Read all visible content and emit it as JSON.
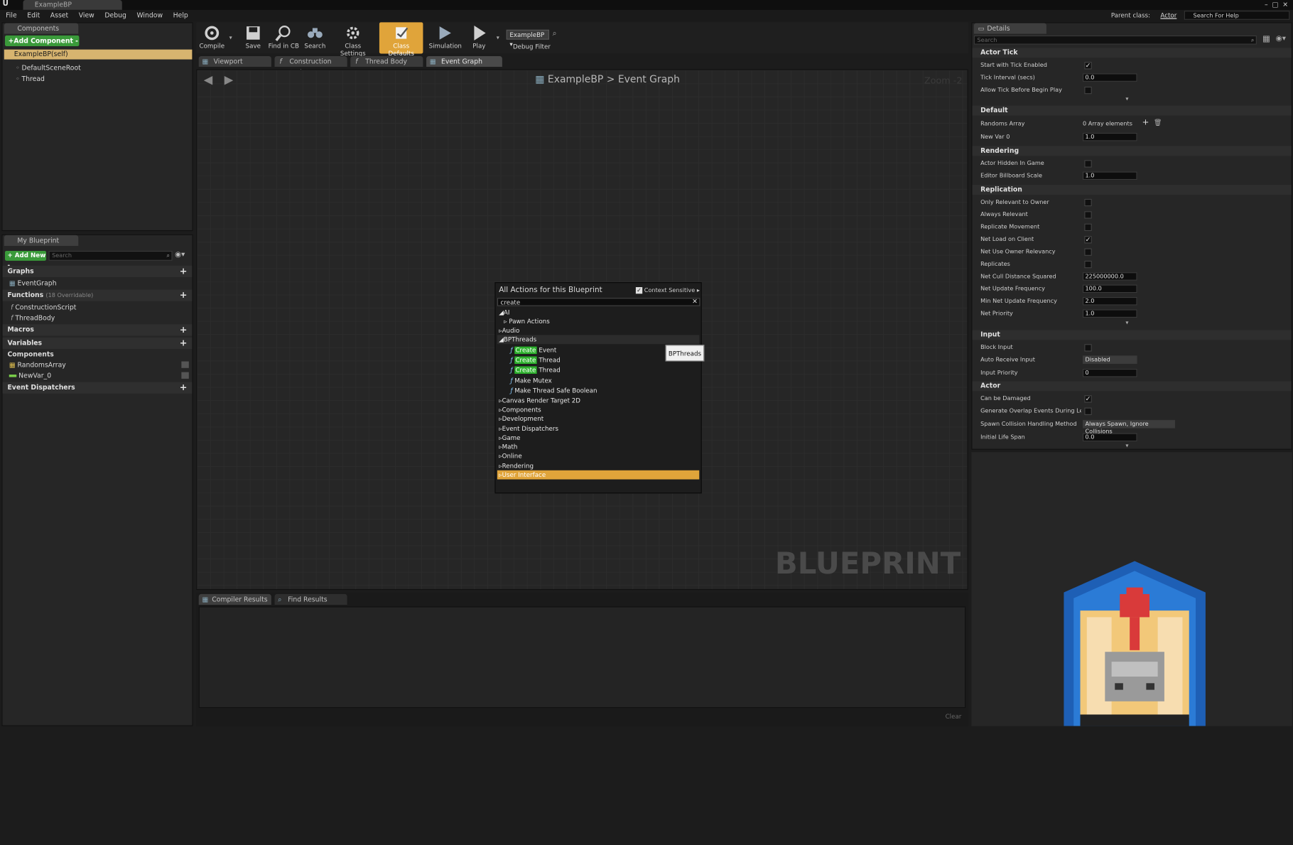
{
  "window": {
    "title": "ExampleBP"
  },
  "menu": [
    "File",
    "Edit",
    "Asset",
    "View",
    "Debug",
    "Window",
    "Help"
  ],
  "top_right": {
    "parent_class_label": "Parent class:",
    "parent_class_value": "Actor",
    "help_search_placeholder": "Search For Help"
  },
  "components": {
    "tab": "Components",
    "add_button": "+Add Component -",
    "items": [
      "ExampleBP(self)",
      "DefaultSceneRoot",
      "Thread"
    ]
  },
  "my_blueprint": {
    "tab": "My Blueprint",
    "add_new": "+ Add New -",
    "search_placeholder": "Search",
    "graphs_label": "Graphs",
    "graphs": [
      "EventGraph"
    ],
    "functions_label": "Functions",
    "functions_overridable": "(18 Overridable)",
    "functions": [
      "ConstructionScript",
      "ThreadBody"
    ],
    "macros_label": "Macros",
    "variables_label": "Variables",
    "components_label": "Components",
    "variables": [
      "RandomsArray",
      "NewVar_0"
    ],
    "dispatchers_label": "Event Dispatchers"
  },
  "toolbar": {
    "compile": "Compile",
    "save": "Save",
    "find_cb": "Find in CB",
    "search": "Search",
    "class_settings": "Class Settings",
    "class_defaults": "Class Defaults",
    "simulation": "Simulation",
    "play": "Play",
    "debug_select": "ExampleBP",
    "debug_filter": "Debug Filter"
  },
  "graph_tabs": [
    "Viewport",
    "Construction Script",
    "Thread Body",
    "Event Graph"
  ],
  "graph": {
    "breadcrumb_root": "ExampleBP",
    "breadcrumb_sep": ">",
    "breadcrumb_leaf": "Event Graph",
    "zoom": "Zoom -2",
    "watermark": "BLUEPRINT"
  },
  "actions": {
    "title": "All Actions for this Blueprint",
    "context_sensitive": "Context Sensitive",
    "search_value": "create",
    "tooltip": "BPThreads",
    "ai": "AI",
    "pawn_actions": "Pawn Actions",
    "audio": "Audio",
    "bpthreads": "BPThreads",
    "create_word": "Create",
    "create_event_rest": " Event",
    "create_thread_rest": " Thread",
    "make_mutex": "Make Mutex",
    "make_bool": "Make Thread Safe Boolean",
    "categories": [
      "Canvas Render Target 2D",
      "Components",
      "Development",
      "Event Dispatchers",
      "Game",
      "Math",
      "Online",
      "Rendering"
    ],
    "selected": "User Interface"
  },
  "bottom": {
    "tabs": [
      "Compiler Results",
      "Find Results"
    ],
    "clear": "Clear"
  },
  "details": {
    "tab": "Details",
    "search_placeholder": "Search",
    "sections": {
      "actor_tick": "Actor Tick",
      "default": "Default",
      "rendering": "Rendering",
      "replication": "Replication",
      "input": "Input",
      "actor": "Actor"
    },
    "actor_tick": {
      "start_tick": "Start with Tick Enabled",
      "tick_interval": "Tick Interval (secs)",
      "tick_interval_val": "0.0",
      "allow_tick": "Allow Tick Before Begin Play"
    },
    "default": {
      "randoms": "Randoms Array",
      "randoms_val": "0 Array elements",
      "newvar": "New Var 0",
      "newvar_val": "1.0"
    },
    "rendering": {
      "hidden": "Actor Hidden In Game",
      "billboard": "Editor Billboard Scale",
      "billboard_val": "1.0"
    },
    "replication": {
      "only_relevant": "Only Relevant to Owner",
      "always_relevant": "Always Relevant",
      "rep_movement": "Replicate Movement",
      "net_load": "Net Load on Client",
      "net_use_owner": "Net Use Owner Relevancy",
      "replicates": "Replicates",
      "cull": "Net Cull Distance Squared",
      "cull_val": "225000000.0",
      "update_freq": "Net Update Frequency",
      "update_freq_val": "100.0",
      "min_update": "Min Net Update Frequency",
      "min_update_val": "2.0",
      "priority": "Net Priority",
      "priority_val": "1.0"
    },
    "input": {
      "block": "Block Input",
      "auto_receive": "Auto Receive Input",
      "auto_receive_val": "Disabled",
      "priority": "Input Priority",
      "priority_val": "0"
    },
    "actor": {
      "damaged": "Can be Damaged",
      "overlap": "Generate Overlap Events During Level S",
      "spawn": "Spawn Collision Handling Method",
      "spawn_val": "Always Spawn, Ignore Collisions",
      "life": "Initial Life Span",
      "life_val": "0.0"
    }
  },
  "colors": {
    "accent": "#e0a43a",
    "add_green": "#3a9a3a",
    "highlight_green": "#2db12d"
  }
}
